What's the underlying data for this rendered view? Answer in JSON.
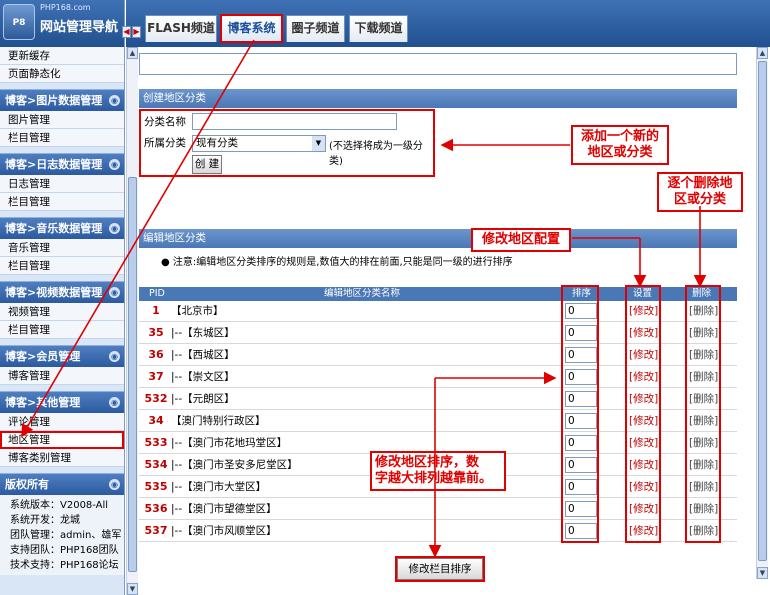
{
  "logo": {
    "site": "PHP168.com",
    "title": "网站管理导航"
  },
  "tabs": [
    "FLASH频道",
    "博客系统",
    "圈子频道",
    "下载频道"
  ],
  "sidebar": {
    "top_items": [
      "更新缓存",
      "页面静态化"
    ],
    "groups": [
      {
        "title": "博客>图片数据管理",
        "items": [
          "图片管理",
          "栏目管理"
        ]
      },
      {
        "title": "博客>日志数据管理",
        "items": [
          "日志管理",
          "栏目管理"
        ]
      },
      {
        "title": "博客>音乐数据管理",
        "items": [
          "音乐管理",
          "栏目管理"
        ]
      },
      {
        "title": "博客>视频数据管理",
        "items": [
          "视频管理",
          "栏目管理"
        ]
      },
      {
        "title": "博客>会员管理",
        "items": [
          "博客管理"
        ]
      },
      {
        "title": "博客>其他管理",
        "items": [
          "评论管理",
          "地区管理",
          "博客类别管理"
        ]
      }
    ],
    "copyright": {
      "title": "版权所有",
      "lines": [
        "系统版本：V2008-All",
        "系统开发：龙城",
        "团队管理：admin、雄军",
        "支持团队：PHP168团队",
        "技术支持：PHP168论坛"
      ]
    }
  },
  "create": {
    "header": "创建地区分类",
    "name_label": "分类名称",
    "name_value": "",
    "parent_label": "所属分类",
    "parent_value": "现有分类",
    "parent_note": "(不选择将成为一级分类)",
    "submit": "创 建"
  },
  "edit": {
    "header": "编辑地区分类",
    "notice": "注意:编辑地区分类排序的规则是,数值大的排在前面,只能是同一级的进行排序",
    "columns": [
      "PID",
      "编辑地区分类名称",
      "排序",
      "设置",
      "删除"
    ],
    "edit_label": "[修改]",
    "delete_label": "[删除]",
    "rows": [
      {
        "pid": "1",
        "name": "【北京市】",
        "order": "0"
      },
      {
        "pid": "35",
        "name": "|--【东城区】",
        "order": "0"
      },
      {
        "pid": "36",
        "name": "|--【西城区】",
        "order": "0"
      },
      {
        "pid": "37",
        "name": "|--【崇文区】",
        "order": "0"
      },
      {
        "pid": "532",
        "name": "|--【元朗区】",
        "order": "0"
      },
      {
        "pid": "34",
        "name": "【澳门特别行政区】",
        "order": "0"
      },
      {
        "pid": "533",
        "name": "|--【澳门市花地玛堂区】",
        "order": "0"
      },
      {
        "pid": "534",
        "name": "|--【澳门市圣安多尼堂区】",
        "order": "0"
      },
      {
        "pid": "535",
        "name": "|--【澳门市大堂区】",
        "order": "0"
      },
      {
        "pid": "536",
        "name": "|--【澳门市望德堂区】",
        "order": "0"
      },
      {
        "pid": "537",
        "name": "|--【澳门市风顺堂区】",
        "order": "0"
      }
    ],
    "sort_button": "修改栏目排序"
  },
  "callouts": {
    "add": "添加一个新的\n地区或分类",
    "delete": "逐个删除地\n区或分类",
    "modify": "修改地区配置",
    "sort": "修改地区排序，数\n字越大排列越靠前。"
  },
  "colors": {
    "accent": "#e00000",
    "header_blue": "#4a77b6",
    "sidebar_bg": "#d8e6f5"
  }
}
